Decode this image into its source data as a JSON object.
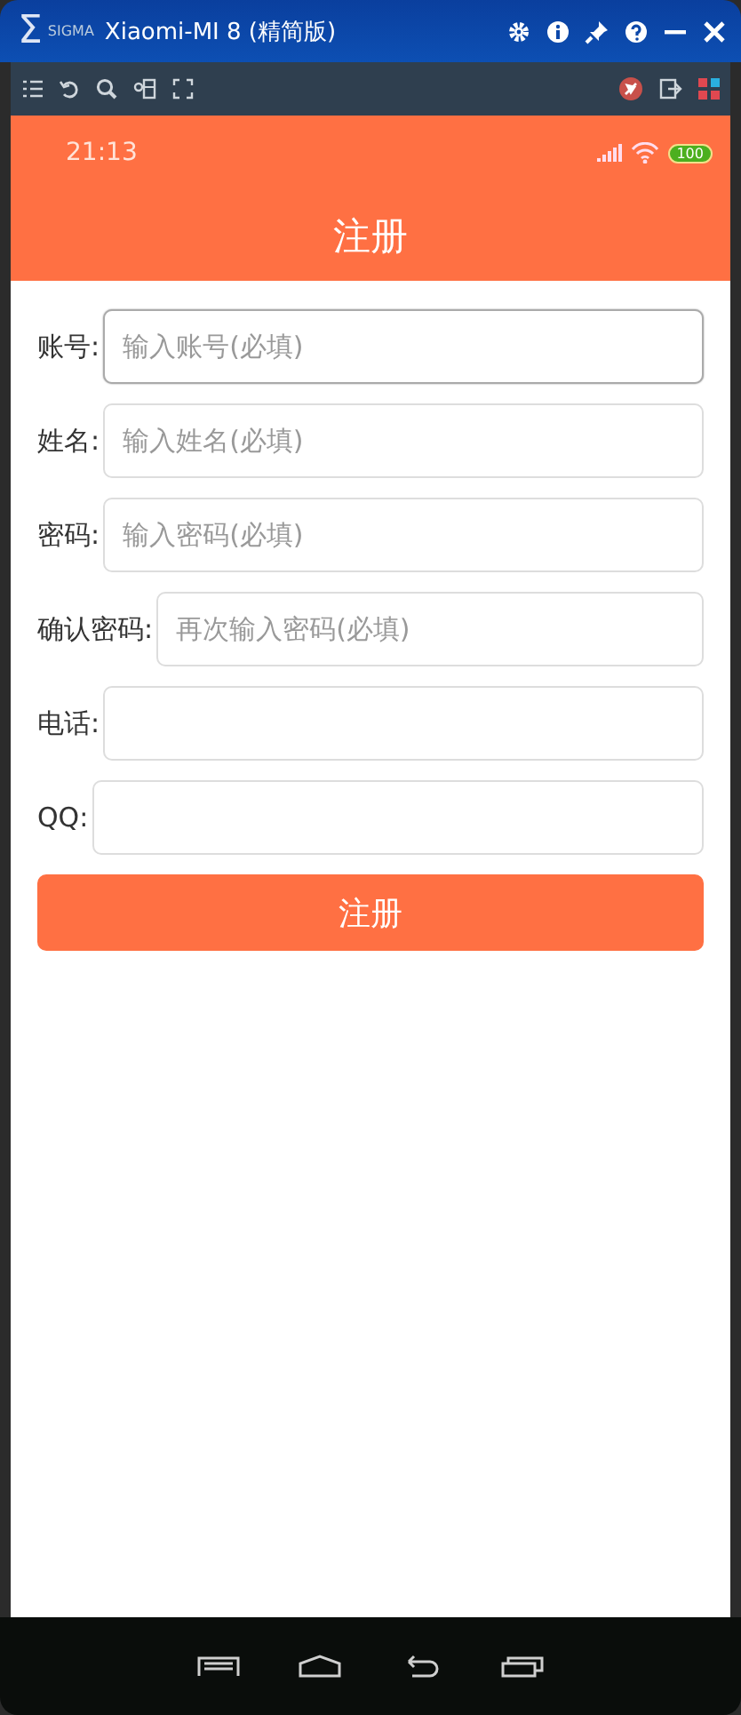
{
  "window": {
    "logo_mark": "Σ",
    "logo_text": "SIGMA",
    "title": "Xiaomi-MI 8 (精简版)"
  },
  "status_bar": {
    "time": "21:13",
    "battery": "100"
  },
  "header": {
    "title": "注册"
  },
  "form": {
    "fields": [
      {
        "label": "账号:",
        "placeholder": "输入账号(必填)",
        "focused": true
      },
      {
        "label": "姓名:",
        "placeholder": "输入姓名(必填)",
        "focused": false
      },
      {
        "label": "密码:",
        "placeholder": "输入密码(必填)",
        "focused": false
      },
      {
        "label": "确认密码:",
        "placeholder": "再次输入密码(必填)",
        "focused": false
      },
      {
        "label": "电话:",
        "focused": false
      },
      {
        "label": "QQ:",
        "focused": false
      }
    ],
    "submit": "注册"
  }
}
